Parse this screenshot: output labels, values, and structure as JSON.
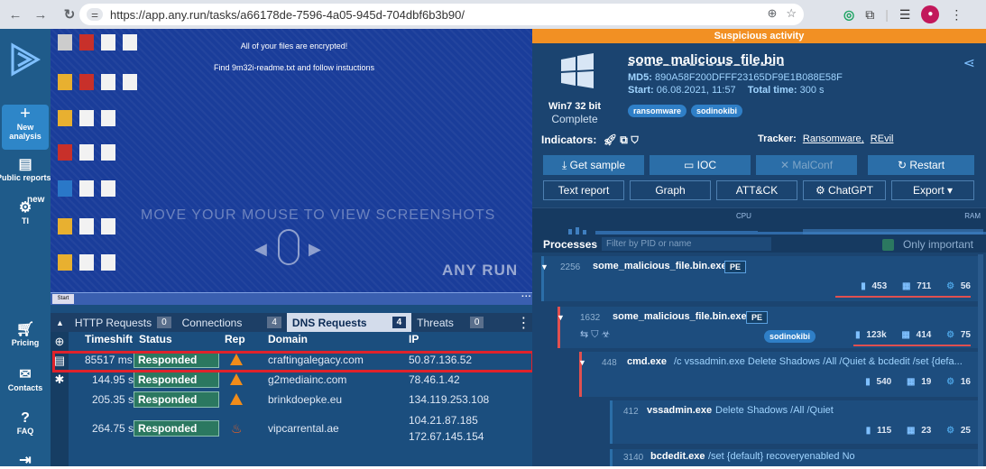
{
  "browser": {
    "url": "https://app.any.run/tasks/a66178de-7596-4a05-945d-704dbf6b3b90/"
  },
  "sidebar": {
    "new_analysis": "New analysis",
    "items": [
      {
        "label": "Public reports",
        "icon": "reports-icon"
      },
      {
        "label": "TI",
        "icon": "ti-icon",
        "badge": "new"
      },
      {
        "label": "Pricing",
        "icon": "cart-icon"
      },
      {
        "label": "Contacts",
        "icon": "mail-icon"
      },
      {
        "label": "FAQ",
        "icon": "help-icon"
      }
    ]
  },
  "screenshot": {
    "ransom_line1": "All of your files are encrypted!",
    "ransom_line2": "Find 9m32i-readme.txt and follow instuctions",
    "hover_hint": "MOVE YOUR MOUSE TO VIEW SCREENSHOTS",
    "watermark": "ANY RUN"
  },
  "network": {
    "tabs": [
      {
        "label": "HTTP Requests",
        "count": "0"
      },
      {
        "label": "Connections",
        "count": "4"
      },
      {
        "label": "DNS Requests",
        "count": "4"
      },
      {
        "label": "Threats",
        "count": "0"
      }
    ],
    "columns": [
      "Timeshift",
      "Status",
      "Rep",
      "Domain",
      "IP"
    ],
    "rows": [
      {
        "timeshift": "85517 ms",
        "status": "Responded",
        "rep": "warning",
        "domain": "craftingalegacy.com",
        "ip": "50.87.136.52"
      },
      {
        "timeshift": "144.95 s",
        "status": "Responded",
        "rep": "warning",
        "domain": "g2mediainc.com",
        "ip": "78.46.1.42"
      },
      {
        "timeshift": "205.35 s",
        "status": "Responded",
        "rep": "warning",
        "domain": "brinkdoepke.eu",
        "ip": "134.119.253.108"
      },
      {
        "timeshift": "264.75 s",
        "status": "Responded",
        "rep": "danger",
        "domain": "vipcarrental.ae",
        "ip": "104.21.87.185",
        "ip2": "172.67.145.154"
      }
    ]
  },
  "report": {
    "banner": "Suspicious activity",
    "filename": "some_malicious_file.bin",
    "md5_label": "MD5:",
    "md5": "890A58F200DFFF23165DF9E1B088E58F",
    "start_label": "Start:",
    "start": "06.08.2021, 11:57",
    "total_label": "Total time:",
    "total": "300 s",
    "os": "Win7 32 bit",
    "os_status": "Complete",
    "tags": [
      "ransomware",
      "sodinokibi"
    ],
    "indicators_label": "Indicators:",
    "tracker_label": "Tracker:",
    "tracker_links": [
      "Ransomware,",
      "REvil"
    ],
    "buttons_row1": [
      "Get sample",
      "IOC",
      "MalConf",
      "Restart"
    ],
    "buttons_row2": [
      "Text report",
      "Graph",
      "ATT&CK",
      "ChatGPT",
      "Export"
    ],
    "cpu_label": "CPU",
    "ram_label": "RAM",
    "processes_label": "Processes",
    "filter_placeholder": "Filter by PID or name",
    "only_important": "Only important",
    "processes": [
      {
        "pid": "2256",
        "name": "some_malicious_file.bin.exe",
        "cmd": "",
        "pe": "PE",
        "files": "453",
        "reg": "711",
        "gear": "56"
      },
      {
        "pid": "1632",
        "name": "some_malicious_file.bin.exe",
        "cmd": "",
        "pe": "PE",
        "tag": "sodinokibi",
        "files": "123k",
        "reg": "414",
        "gear": "75"
      },
      {
        "pid": "448",
        "name": "cmd.exe",
        "cmd": "/c vssadmin.exe Delete Shadows /All /Quiet & bcdedit /set {defa...",
        "files": "540",
        "reg": "19",
        "gear": "16"
      },
      {
        "pid": "412",
        "name": "vssadmin.exe",
        "cmd": "Delete Shadows /All /Quiet",
        "files": "115",
        "reg": "23",
        "gear": "25"
      },
      {
        "pid": "3140",
        "name": "bcdedit.exe",
        "cmd": "/set {default} recoveryenabled No"
      }
    ]
  }
}
